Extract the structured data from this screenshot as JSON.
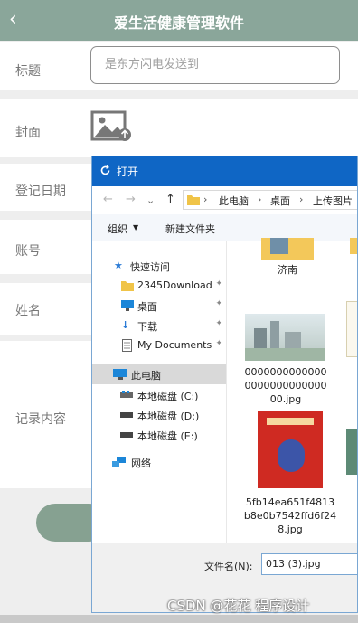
{
  "header": {
    "back_icon": "chevron-left-icon",
    "title": "爱生活健康管理软件",
    "background": "#8aa69a"
  },
  "form": {
    "title_label": "标题",
    "title_placeholder": "是东方闪电发送到",
    "cover_label": "封面",
    "cover_icon": "image-upload-icon",
    "date_label": "登记日期",
    "account_label": "账号",
    "name_label": "姓名",
    "content_label": "记录内容"
  },
  "dialog": {
    "title": "打开",
    "back_icon": "arrow-left-icon",
    "forward_icon": "arrow-right-icon",
    "up_icon": "arrow-up-icon",
    "path": [
      "此电脑",
      "桌面",
      "上传图片"
    ],
    "toolbar": {
      "organize": "组织",
      "new_folder": "新建文件夹"
    },
    "nav": [
      {
        "label": "快速访问",
        "icon": "star-icon"
      },
      {
        "label": "2345Download",
        "icon": "folder-icon",
        "pinned": true
      },
      {
        "label": "桌面",
        "icon": "desktop-icon",
        "pinned": true
      },
      {
        "label": "下载",
        "icon": "download-icon",
        "pinned": true
      },
      {
        "label": "My Documents",
        "icon": "document-icon",
        "pinned": true
      },
      {
        "label": "此电脑",
        "icon": "computer-icon",
        "selected": true
      },
      {
        "label": "本地磁盘 (C:)",
        "icon": "drive-icon"
      },
      {
        "label": "本地磁盘 (D:)",
        "icon": "drive-icon"
      },
      {
        "label": "本地磁盘 (E:)",
        "icon": "drive-icon"
      },
      {
        "label": "网络",
        "icon": "network-icon"
      }
    ],
    "files": [
      {
        "name": "济南",
        "type": "folder"
      },
      {
        "name": "0000000000000000000000000000.jpg",
        "type": "image"
      },
      {
        "name": "5fb14ea651f4813b8e0b7542ffd6f248.jpg",
        "type": "image"
      }
    ],
    "filename_label": "文件名(N):",
    "filename_value": "013 (3).jpg"
  },
  "watermark": "CSDN @花花 程序设计"
}
